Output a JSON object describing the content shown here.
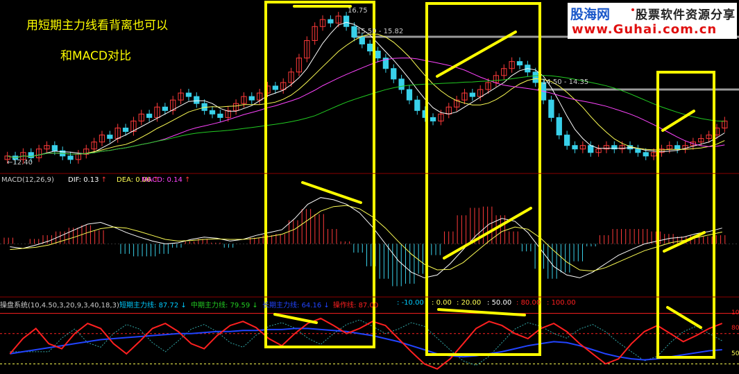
{
  "annotations": {
    "line1": "用短期主力线看背离也可以",
    "line2": "和MACD对比"
  },
  "watermark": {
    "brand": "股海网",
    "slogan": "股票软件资源分享",
    "url": "www.Guhai.com.cn"
  },
  "chart_data": [
    {
      "type": "candlestick",
      "panel": "price",
      "price_labels": {
        "high": "16.75",
        "low": "12.40",
        "level1": "15.82",
        "level1_prefix": "15.50",
        "level2": "14.35",
        "level2_prefix": "14.50"
      },
      "ylim": [
        12.2,
        16.9
      ],
      "close": [
        12.6,
        12.5,
        12.7,
        12.55,
        12.8,
        12.9,
        12.75,
        12.6,
        12.5,
        12.65,
        12.8,
        13.0,
        13.2,
        13.1,
        13.4,
        13.3,
        13.6,
        13.8,
        13.7,
        14.0,
        13.9,
        14.2,
        14.4,
        14.3,
        14.1,
        13.9,
        13.8,
        13.7,
        13.9,
        14.1,
        14.3,
        14.2,
        14.4,
        14.6,
        14.5,
        14.7,
        15.0,
        15.4,
        15.9,
        16.3,
        16.5,
        16.4,
        16.6,
        16.3,
        16.0,
        15.8,
        15.6,
        15.4,
        15.1,
        14.8,
        14.5,
        14.2,
        13.9,
        13.7,
        13.6,
        13.8,
        14.0,
        14.2,
        14.4,
        14.3,
        14.5,
        14.7,
        14.9,
        15.1,
        15.3,
        15.2,
        15.0,
        14.7,
        14.2,
        13.7,
        13.2,
        12.9,
        12.8,
        12.9,
        12.7,
        12.8,
        12.9,
        12.8,
        12.9,
        12.8,
        12.7,
        12.6,
        12.7,
        12.8,
        12.9,
        12.8,
        12.9,
        13.0,
        13.1,
        13.2,
        13.4,
        13.6
      ]
    },
    {
      "type": "line",
      "panel": "macd",
      "title": "MACD(12,26,9)",
      "params": {
        "DIF": "0.13",
        "DEA": "0.06",
        "MACD": "0.14"
      },
      "labels": {
        "dif": "DIF:",
        "dea": "DEA:",
        "macd": "MACD:"
      },
      "ylim": [
        -1.0,
        1.0
      ],
      "dif": [
        -0.05,
        -0.08,
        -0.02,
        0.05,
        0.15,
        0.25,
        0.35,
        0.38,
        0.3,
        0.2,
        0.12,
        0.05,
        0.0,
        0.02,
        0.08,
        0.12,
        0.1,
        0.05,
        0.08,
        0.15,
        0.2,
        0.25,
        0.45,
        0.7,
        0.82,
        0.78,
        0.7,
        0.55,
        0.3,
        0.0,
        -0.3,
        -0.5,
        -0.6,
        -0.55,
        -0.35,
        -0.1,
        0.15,
        0.35,
        0.45,
        0.4,
        0.2,
        -0.1,
        -0.4,
        -0.55,
        -0.6,
        -0.5,
        -0.35,
        -0.2,
        -0.1,
        0.0,
        0.05,
        0.1,
        0.12,
        0.18,
        0.22,
        0.28
      ],
      "dea": [
        -0.1,
        -0.08,
        -0.06,
        -0.02,
        0.05,
        0.12,
        0.2,
        0.27,
        0.3,
        0.28,
        0.22,
        0.15,
        0.08,
        0.05,
        0.06,
        0.08,
        0.09,
        0.08,
        0.08,
        0.1,
        0.13,
        0.17,
        0.26,
        0.42,
        0.58,
        0.66,
        0.68,
        0.62,
        0.48,
        0.28,
        0.04,
        -0.18,
        -0.36,
        -0.46,
        -0.45,
        -0.33,
        -0.14,
        0.05,
        0.22,
        0.3,
        0.26,
        0.1,
        -0.12,
        -0.32,
        -0.46,
        -0.48,
        -0.42,
        -0.32,
        -0.22,
        -0.12,
        -0.05,
        0.02,
        0.06,
        0.11,
        0.16,
        0.21
      ]
    },
    {
      "type": "line",
      "panel": "indicator",
      "title": "操盘系统(10,4.50,3,20,9,3,40,18,3)",
      "series_labels": {
        "short": "短期主力线:",
        "mid": "中期主力线:",
        "long": "长期主力线:",
        "op": "操作线:"
      },
      "values": {
        "short": "87.72",
        "mid": "79.59",
        "long": "64.16",
        "op": "87.00"
      },
      "levels": [
        "-10.00",
        "0.00",
        "20.00",
        "50.00",
        "80.00",
        "100.00"
      ],
      "right_ticks": [
        "100",
        "80",
        "50"
      ],
      "ylim": [
        40,
        110
      ],
      "short": [
        60,
        75,
        85,
        70,
        65,
        80,
        90,
        85,
        70,
        60,
        72,
        85,
        90,
        82,
        70,
        65,
        78,
        88,
        92,
        86,
        75,
        68,
        80,
        90,
        95,
        88,
        80,
        85,
        92,
        88,
        75,
        62,
        50,
        45,
        55,
        70,
        85,
        92,
        88,
        80,
        75,
        85,
        90,
        82,
        70,
        60,
        50,
        55,
        70,
        82,
        88,
        80,
        72,
        78,
        85,
        90
      ],
      "long": [
        60,
        62,
        64,
        66,
        68,
        70,
        72,
        74,
        75,
        76,
        77,
        78,
        79,
        80,
        80,
        81,
        82,
        82,
        83,
        83,
        84,
        84,
        85,
        85,
        84,
        83,
        82,
        80,
        78,
        75,
        72,
        68,
        64,
        60,
        58,
        57,
        58,
        60,
        62,
        65,
        68,
        70,
        72,
        71,
        68,
        64,
        60,
        57,
        55,
        54,
        55,
        57,
        59,
        61,
        63,
        64
      ]
    }
  ],
  "colors": {
    "up": "#ff3a3a",
    "down": "#39d1ea",
    "annotation": "#ffff00",
    "ma5": "#ffffff",
    "ma10": "#ffff55",
    "ma20": "#ff44ff",
    "ma60": "#22cc22",
    "dif": "#ffffff",
    "dea": "#ffff55",
    "macd_label": "#ff44ff",
    "short_line": "#ff2020",
    "long_line": "#2244ff",
    "mid_line": "#22cc22",
    "op_line": "#ff2020",
    "levels": "#00ccff",
    "panel_border": "#8b0000"
  }
}
